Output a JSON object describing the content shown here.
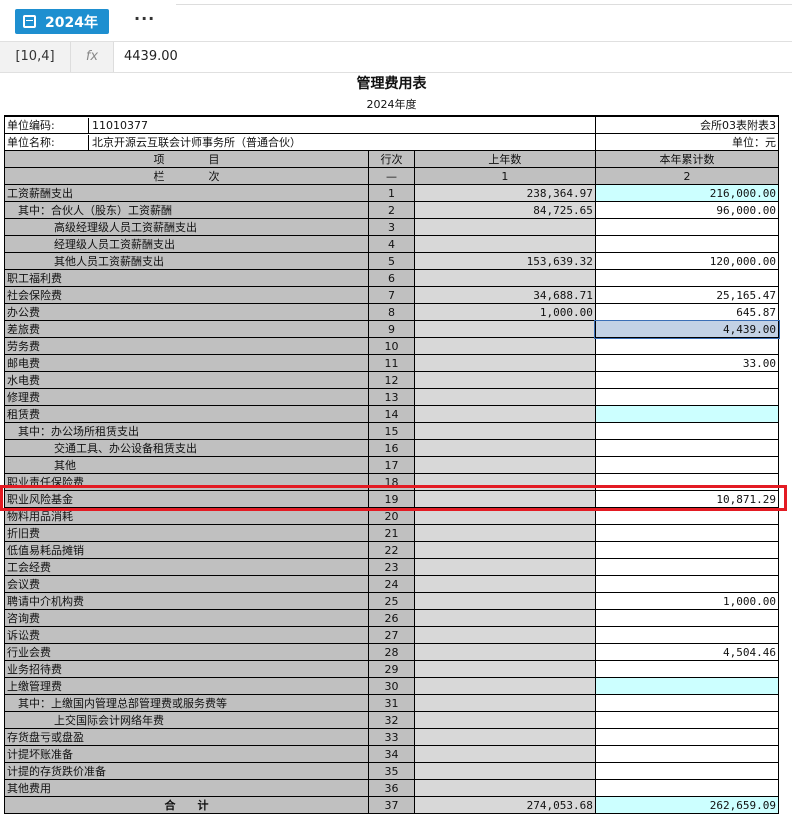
{
  "toolbar": {
    "year_label": "2024年",
    "more_label": "···"
  },
  "formula_bar": {
    "cell_ref": "[10,4]",
    "fx_label": "fx",
    "value": "4439.00"
  },
  "report": {
    "title": "管理费用表",
    "year": "2024年度",
    "unit_code_label": "单位编码:",
    "unit_code": "11010377",
    "form_id": "会所03表附表3",
    "unit_name_label": "单位名称:",
    "unit_name": "北京开源云互联会计师事务所（普通合伙）",
    "currency": "单位：元",
    "headers": {
      "item": "项　　　　目",
      "line": "行次",
      "prev": "上年数",
      "curr": "本年累计数"
    },
    "subheaders": {
      "item": "栏　　　　次",
      "line": "—",
      "prev": "1",
      "curr": "2"
    },
    "rows": [
      {
        "label": "工资薪酬支出",
        "line": "1",
        "prev": "238,364.97",
        "curr": "216,000.00",
        "indent": 0,
        "cc": "cy"
      },
      {
        "label": "其中：合伙人（股东）工资薪酬",
        "line": "2",
        "prev": "84,725.65",
        "curr": "96,000.00",
        "indent": 1,
        "cc": ""
      },
      {
        "label": "高级经理级人员工资薪酬支出",
        "line": "3",
        "prev": "",
        "curr": "",
        "indent": 2,
        "cc": ""
      },
      {
        "label": "经理级人员工资薪酬支出",
        "line": "4",
        "prev": "",
        "curr": "",
        "indent": 2,
        "cc": ""
      },
      {
        "label": "其他人员工资薪酬支出",
        "line": "5",
        "prev": "153,639.32",
        "curr": "120,000.00",
        "indent": 2,
        "cc": ""
      },
      {
        "label": "职工福利费",
        "line": "6",
        "prev": "",
        "curr": "",
        "indent": 0,
        "cc": ""
      },
      {
        "label": "社会保险费",
        "line": "7",
        "prev": "34,688.71",
        "curr": "25,165.47",
        "indent": 0,
        "cc": ""
      },
      {
        "label": "办公费",
        "line": "8",
        "prev": "1,000.00",
        "curr": "645.87",
        "indent": 0,
        "cc": ""
      },
      {
        "label": "差旅费",
        "line": "9",
        "prev": "",
        "curr": "4,439.00",
        "indent": 0,
        "cc": "sel"
      },
      {
        "label": "劳务费",
        "line": "10",
        "prev": "",
        "curr": "",
        "indent": 0,
        "cc": ""
      },
      {
        "label": "邮电费",
        "line": "11",
        "prev": "",
        "curr": "33.00",
        "indent": 0,
        "cc": ""
      },
      {
        "label": "水电费",
        "line": "12",
        "prev": "",
        "curr": "",
        "indent": 0,
        "cc": ""
      },
      {
        "label": "修理费",
        "line": "13",
        "prev": "",
        "curr": "",
        "indent": 0,
        "cc": ""
      },
      {
        "label": "租赁费",
        "line": "14",
        "prev": "",
        "curr": "",
        "indent": 0,
        "cc": "cy"
      },
      {
        "label": "其中：办公场所租赁支出",
        "line": "15",
        "prev": "",
        "curr": "",
        "indent": 1,
        "cc": ""
      },
      {
        "label": "交通工具、办公设备租赁支出",
        "line": "16",
        "prev": "",
        "curr": "",
        "indent": 2,
        "cc": ""
      },
      {
        "label": "其他",
        "line": "17",
        "prev": "",
        "curr": "",
        "indent": 2,
        "cc": ""
      },
      {
        "label": "职业责任保险费",
        "line": "18",
        "prev": "",
        "curr": "",
        "indent": 0,
        "cc": ""
      },
      {
        "label": "职业风险基金",
        "line": "19",
        "prev": "",
        "curr": "10,871.29",
        "indent": 0,
        "cc": ""
      },
      {
        "label": "物料用品消耗",
        "line": "20",
        "prev": "",
        "curr": "",
        "indent": 0,
        "cc": ""
      },
      {
        "label": "折旧费",
        "line": "21",
        "prev": "",
        "curr": "",
        "indent": 0,
        "cc": ""
      },
      {
        "label": "低值易耗品摊销",
        "line": "22",
        "prev": "",
        "curr": "",
        "indent": 0,
        "cc": ""
      },
      {
        "label": "工会经费",
        "line": "23",
        "prev": "",
        "curr": "",
        "indent": 0,
        "cc": ""
      },
      {
        "label": "会议费",
        "line": "24",
        "prev": "",
        "curr": "",
        "indent": 0,
        "cc": ""
      },
      {
        "label": "聘请中介机构费",
        "line": "25",
        "prev": "",
        "curr": "1,000.00",
        "indent": 0,
        "cc": ""
      },
      {
        "label": "咨询费",
        "line": "26",
        "prev": "",
        "curr": "",
        "indent": 0,
        "cc": ""
      },
      {
        "label": "诉讼费",
        "line": "27",
        "prev": "",
        "curr": "",
        "indent": 0,
        "cc": ""
      },
      {
        "label": "行业会费",
        "line": "28",
        "prev": "",
        "curr": "4,504.46",
        "indent": 0,
        "cc": ""
      },
      {
        "label": "业务招待费",
        "line": "29",
        "prev": "",
        "curr": "",
        "indent": 0,
        "cc": ""
      },
      {
        "label": "上缴管理费",
        "line": "30",
        "prev": "",
        "curr": "",
        "indent": 0,
        "cc": "cy"
      },
      {
        "label": "其中：上缴国内管理总部管理费或服务费等",
        "line": "31",
        "prev": "",
        "curr": "",
        "indent": 1,
        "cc": ""
      },
      {
        "label": "上交国际会计网络年费",
        "line": "32",
        "prev": "",
        "curr": "",
        "indent": 2,
        "cc": ""
      },
      {
        "label": "存货盘亏或盘盈",
        "line": "33",
        "prev": "",
        "curr": "",
        "indent": 0,
        "cc": ""
      },
      {
        "label": "计提坏账准备",
        "line": "34",
        "prev": "",
        "curr": "",
        "indent": 0,
        "cc": ""
      },
      {
        "label": "计提的存货跌价准备",
        "line": "35",
        "prev": "",
        "curr": "",
        "indent": 0,
        "cc": ""
      },
      {
        "label": "其他费用",
        "line": "36",
        "prev": "",
        "curr": "",
        "indent": 0,
        "cc": ""
      }
    ],
    "total": {
      "label": "合　　计",
      "line": "37",
      "prev": "274,053.68",
      "curr": "262,659.09"
    }
  }
}
